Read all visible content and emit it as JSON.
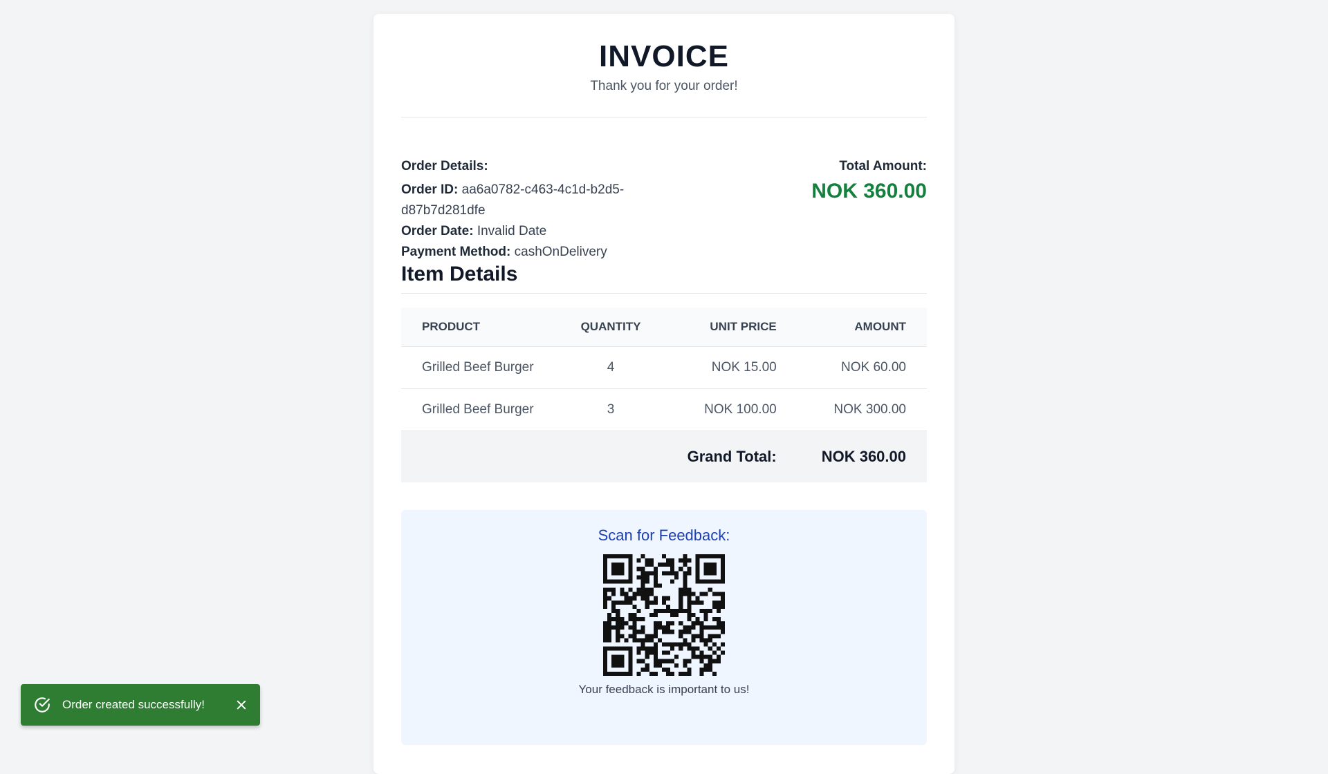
{
  "invoice": {
    "title": "INVOICE",
    "subtitle": "Thank you for your order!"
  },
  "order": {
    "heading": "Order Details:",
    "id_label": "Order ID:",
    "id_value": "aa6a0782-c463-4c1d-b2d5-d87b7d281dfe",
    "date_label": "Order Date:",
    "date_value": "Invalid Date",
    "payment_label": "Payment Method:",
    "payment_value": "cashOnDelivery"
  },
  "total": {
    "label": "Total Amount:",
    "value": "NOK 360.00"
  },
  "items": {
    "title": "Item Details",
    "columns": [
      "PRODUCT",
      "QUANTITY",
      "UNIT PRICE",
      "AMOUNT"
    ],
    "rows": [
      {
        "product": "Grilled Beef Burger",
        "quantity": "4",
        "unit_price": "NOK 15.00",
        "amount": "NOK 60.00"
      },
      {
        "product": "Grilled Beef Burger",
        "quantity": "3",
        "unit_price": "NOK 100.00",
        "amount": "NOK 300.00"
      }
    ],
    "grand_total_label": "Grand Total:",
    "grand_total_value": "NOK 360.00"
  },
  "feedback": {
    "title": "Scan for Feedback:",
    "note": "Your feedback is important to us!",
    "qr_icon": "qr-code"
  },
  "toast": {
    "message": "Order created successfully!",
    "icon": "check-circle-icon",
    "close_icon": "close-icon",
    "color": "#2e7d32"
  },
  "colors": {
    "accent_total": "#15803d",
    "feedback_title": "#1e40af",
    "feedback_bg": "#eff6ff"
  }
}
